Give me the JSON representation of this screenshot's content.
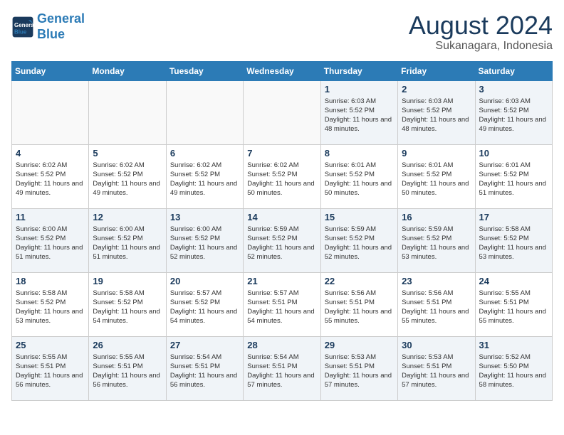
{
  "header": {
    "logo_line1": "General",
    "logo_line2": "Blue",
    "month_year": "August 2024",
    "location": "Sukanagara, Indonesia"
  },
  "days_of_week": [
    "Sunday",
    "Monday",
    "Tuesday",
    "Wednesday",
    "Thursday",
    "Friday",
    "Saturday"
  ],
  "weeks": [
    [
      {
        "day": "",
        "empty": true
      },
      {
        "day": "",
        "empty": true
      },
      {
        "day": "",
        "empty": true
      },
      {
        "day": "",
        "empty": true
      },
      {
        "day": "1",
        "sunrise": "6:03 AM",
        "sunset": "5:52 PM",
        "daylight": "11 hours and 48 minutes."
      },
      {
        "day": "2",
        "sunrise": "6:03 AM",
        "sunset": "5:52 PM",
        "daylight": "11 hours and 48 minutes."
      },
      {
        "day": "3",
        "sunrise": "6:03 AM",
        "sunset": "5:52 PM",
        "daylight": "11 hours and 49 minutes."
      }
    ],
    [
      {
        "day": "4",
        "sunrise": "6:02 AM",
        "sunset": "5:52 PM",
        "daylight": "11 hours and 49 minutes."
      },
      {
        "day": "5",
        "sunrise": "6:02 AM",
        "sunset": "5:52 PM",
        "daylight": "11 hours and 49 minutes."
      },
      {
        "day": "6",
        "sunrise": "6:02 AM",
        "sunset": "5:52 PM",
        "daylight": "11 hours and 49 minutes."
      },
      {
        "day": "7",
        "sunrise": "6:02 AM",
        "sunset": "5:52 PM",
        "daylight": "11 hours and 50 minutes."
      },
      {
        "day": "8",
        "sunrise": "6:01 AM",
        "sunset": "5:52 PM",
        "daylight": "11 hours and 50 minutes."
      },
      {
        "day": "9",
        "sunrise": "6:01 AM",
        "sunset": "5:52 PM",
        "daylight": "11 hours and 50 minutes."
      },
      {
        "day": "10",
        "sunrise": "6:01 AM",
        "sunset": "5:52 PM",
        "daylight": "11 hours and 51 minutes."
      }
    ],
    [
      {
        "day": "11",
        "sunrise": "6:00 AM",
        "sunset": "5:52 PM",
        "daylight": "11 hours and 51 minutes."
      },
      {
        "day": "12",
        "sunrise": "6:00 AM",
        "sunset": "5:52 PM",
        "daylight": "11 hours and 51 minutes."
      },
      {
        "day": "13",
        "sunrise": "6:00 AM",
        "sunset": "5:52 PM",
        "daylight": "11 hours and 52 minutes."
      },
      {
        "day": "14",
        "sunrise": "5:59 AM",
        "sunset": "5:52 PM",
        "daylight": "11 hours and 52 minutes."
      },
      {
        "day": "15",
        "sunrise": "5:59 AM",
        "sunset": "5:52 PM",
        "daylight": "11 hours and 52 minutes."
      },
      {
        "day": "16",
        "sunrise": "5:59 AM",
        "sunset": "5:52 PM",
        "daylight": "11 hours and 53 minutes."
      },
      {
        "day": "17",
        "sunrise": "5:58 AM",
        "sunset": "5:52 PM",
        "daylight": "11 hours and 53 minutes."
      }
    ],
    [
      {
        "day": "18",
        "sunrise": "5:58 AM",
        "sunset": "5:52 PM",
        "daylight": "11 hours and 53 minutes."
      },
      {
        "day": "19",
        "sunrise": "5:58 AM",
        "sunset": "5:52 PM",
        "daylight": "11 hours and 54 minutes."
      },
      {
        "day": "20",
        "sunrise": "5:57 AM",
        "sunset": "5:52 PM",
        "daylight": "11 hours and 54 minutes."
      },
      {
        "day": "21",
        "sunrise": "5:57 AM",
        "sunset": "5:51 PM",
        "daylight": "11 hours and 54 minutes."
      },
      {
        "day": "22",
        "sunrise": "5:56 AM",
        "sunset": "5:51 PM",
        "daylight": "11 hours and 55 minutes."
      },
      {
        "day": "23",
        "sunrise": "5:56 AM",
        "sunset": "5:51 PM",
        "daylight": "11 hours and 55 minutes."
      },
      {
        "day": "24",
        "sunrise": "5:55 AM",
        "sunset": "5:51 PM",
        "daylight": "11 hours and 55 minutes."
      }
    ],
    [
      {
        "day": "25",
        "sunrise": "5:55 AM",
        "sunset": "5:51 PM",
        "daylight": "11 hours and 56 minutes."
      },
      {
        "day": "26",
        "sunrise": "5:55 AM",
        "sunset": "5:51 PM",
        "daylight": "11 hours and 56 minutes."
      },
      {
        "day": "27",
        "sunrise": "5:54 AM",
        "sunset": "5:51 PM",
        "daylight": "11 hours and 56 minutes."
      },
      {
        "day": "28",
        "sunrise": "5:54 AM",
        "sunset": "5:51 PM",
        "daylight": "11 hours and 57 minutes."
      },
      {
        "day": "29",
        "sunrise": "5:53 AM",
        "sunset": "5:51 PM",
        "daylight": "11 hours and 57 minutes."
      },
      {
        "day": "30",
        "sunrise": "5:53 AM",
        "sunset": "5:51 PM",
        "daylight": "11 hours and 57 minutes."
      },
      {
        "day": "31",
        "sunrise": "5:52 AM",
        "sunset": "5:50 PM",
        "daylight": "11 hours and 58 minutes."
      }
    ]
  ],
  "labels": {
    "sunrise": "Sunrise:",
    "sunset": "Sunset:",
    "daylight": "Daylight:"
  }
}
